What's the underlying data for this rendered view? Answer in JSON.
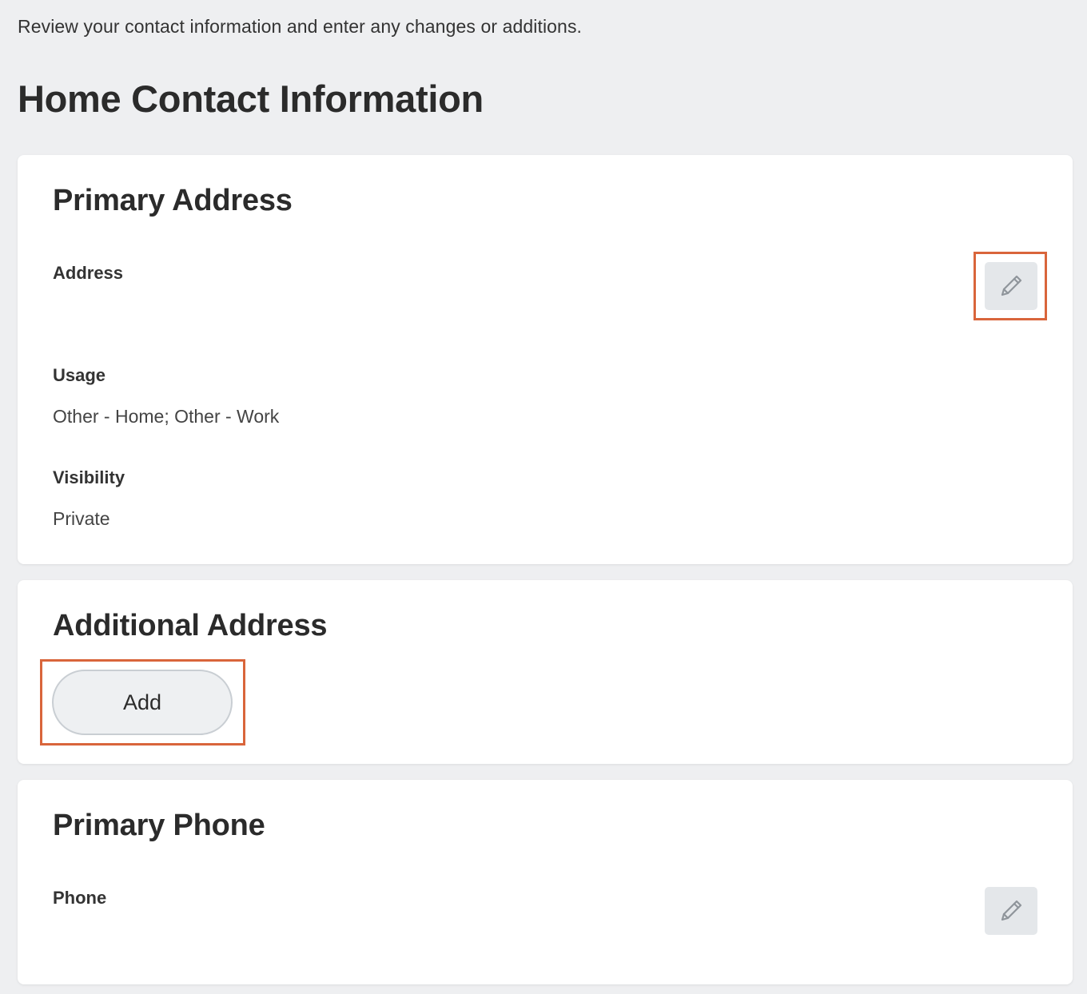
{
  "intro_text": "Review your contact information and enter any changes or additions.",
  "page_title": "Home Contact Information",
  "primary_address": {
    "title": "Primary Address",
    "address_label": "Address",
    "address_value": "",
    "usage_label": "Usage",
    "usage_value": "Other - Home; Other - Work",
    "visibility_label": "Visibility",
    "visibility_value": "Private",
    "edit_icon": "pencil-icon"
  },
  "additional_address": {
    "title": "Additional Address",
    "add_label": "Add"
  },
  "primary_phone": {
    "title": "Primary Phone",
    "phone_label": "Phone",
    "phone_value": "",
    "edit_icon": "pencil-icon"
  },
  "colors": {
    "page_background": "#eeeff1",
    "card_background": "#ffffff",
    "highlight": "#d9653b",
    "edit_button_background": "#e4e7ea",
    "icon_color": "#8f959b"
  }
}
